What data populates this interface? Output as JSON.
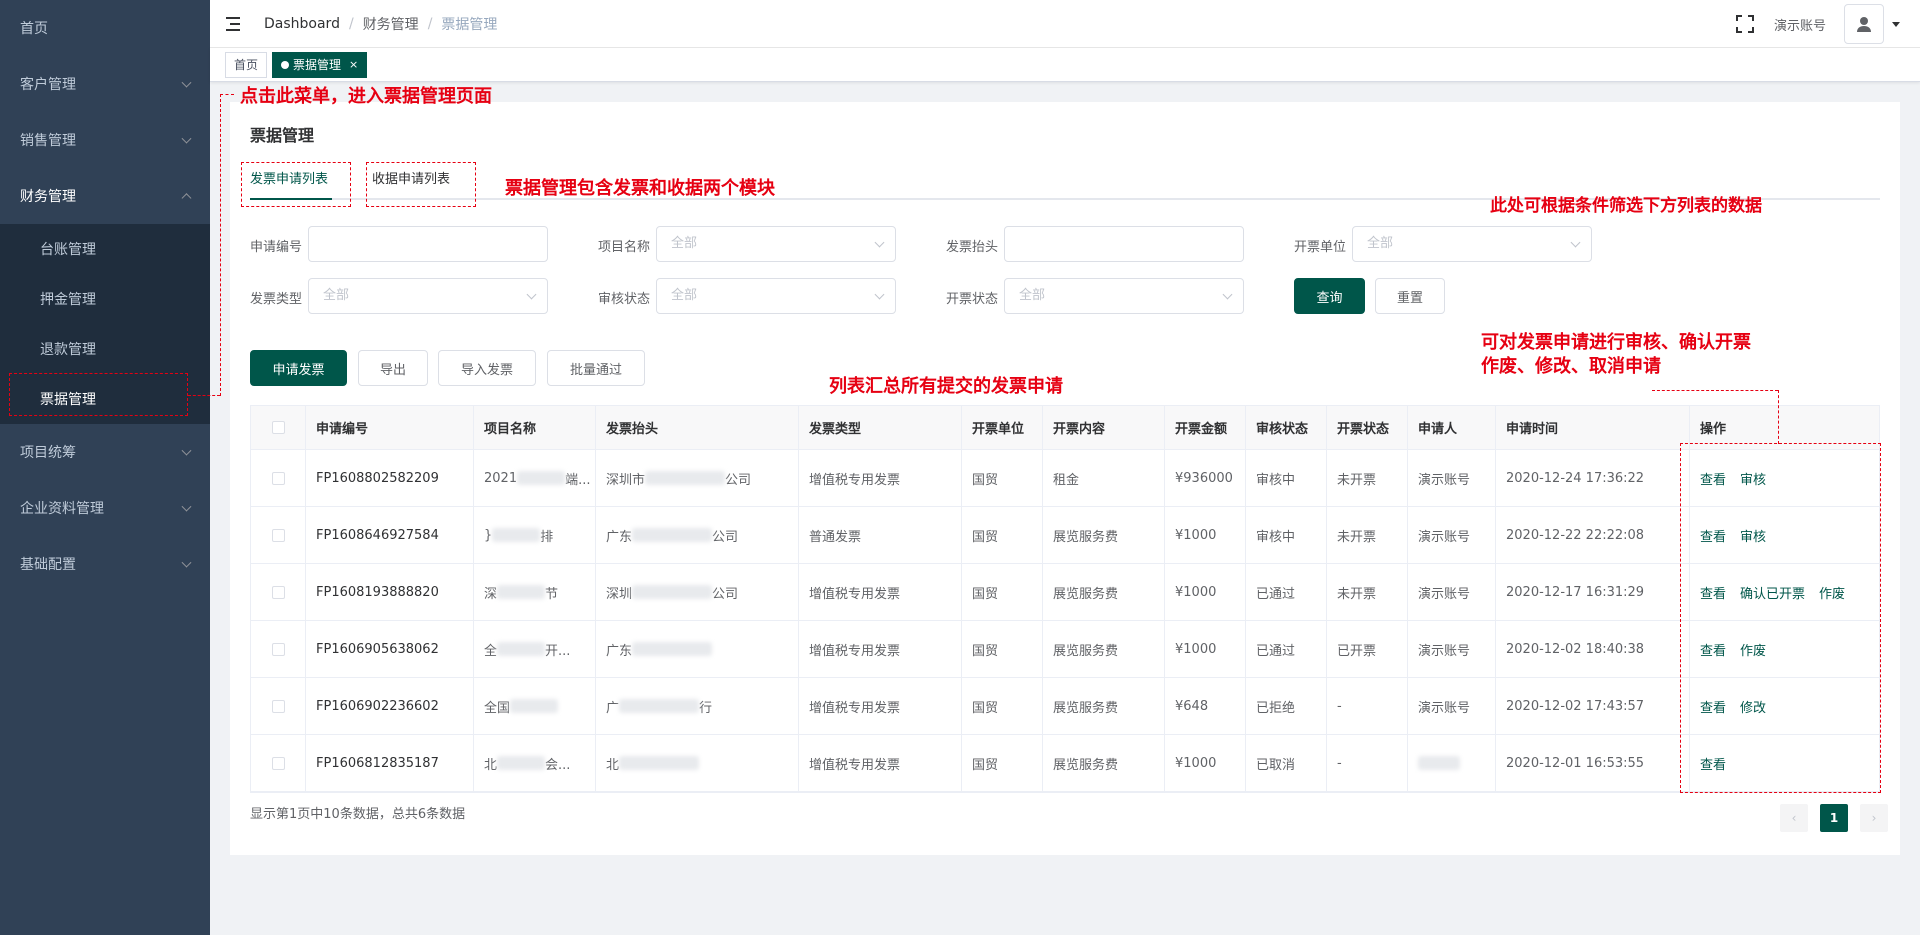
{
  "sidebar": {
    "home": "首页",
    "items": [
      {
        "label": "客户管理"
      },
      {
        "label": "销售管理"
      },
      {
        "label": "财务管理"
      }
    ],
    "finance_sub": [
      {
        "label": "台账管理"
      },
      {
        "label": "押金管理"
      },
      {
        "label": "退款管理"
      },
      {
        "label": "票据管理"
      }
    ],
    "items_after": [
      {
        "label": "项目统筹"
      },
      {
        "label": "企业资料管理"
      },
      {
        "label": "基础配置"
      }
    ]
  },
  "navbar": {
    "breadcrumb": [
      "Dashboard",
      "财务管理",
      "票据管理"
    ],
    "separator": "/",
    "user_name": "演示账号"
  },
  "tags": {
    "home": "首页",
    "active": "票据管理",
    "close": "×"
  },
  "page": {
    "title": "票据管理",
    "tabs": [
      "发票申请列表",
      "收据申请列表"
    ]
  },
  "filters": {
    "apply_no": {
      "label": "申请编号",
      "value": ""
    },
    "project": {
      "label": "项目名称",
      "placeholder": "全部"
    },
    "invoice_header": {
      "label": "发票抬头",
      "value": ""
    },
    "issuer": {
      "label": "开票单位",
      "placeholder": "全部"
    },
    "invoice_type": {
      "label": "发票类型",
      "placeholder": "全部"
    },
    "audit_status": {
      "label": "审核状态",
      "placeholder": "全部"
    },
    "invoice_status": {
      "label": "开票状态",
      "placeholder": "全部"
    },
    "query_btn": "查询",
    "reset_btn": "重置"
  },
  "actions": {
    "apply": "申请发票",
    "export": "导出",
    "import": "导入发票",
    "batch_approve": "批量通过"
  },
  "table": {
    "columns": [
      "申请编号",
      "项目名称",
      "发票抬头",
      "发票类型",
      "开票单位",
      "开票内容",
      "开票金额",
      "审核状态",
      "开票状态",
      "申请人",
      "申请时间",
      "操作"
    ],
    "rows": [
      {
        "code": "FP1608802582209",
        "project_a": "2021",
        "project_b": "端...",
        "header_a": "深圳市",
        "header_b": "公司",
        "type": "增值税专用发票",
        "unit": "国贸",
        "content": "租金",
        "amount": "¥936000",
        "audit": "审核中",
        "invoice": "未开票",
        "applicant": "演示账号",
        "time": "2020-12-24 17:36:22",
        "ops": [
          "查看",
          "审核"
        ]
      },
      {
        "code": "FP1608646927584",
        "project_a": "}",
        "project_b": "排",
        "header_a": "广东",
        "header_b": "公司",
        "type": "普通发票",
        "unit": "国贸",
        "content": "展览服务费",
        "amount": "¥1000",
        "audit": "审核中",
        "invoice": "未开票",
        "applicant": "演示账号",
        "time": "2020-12-22 22:22:08",
        "ops": [
          "查看",
          "审核"
        ]
      },
      {
        "code": "FP1608193888820",
        "project_a": "深",
        "project_b": "节",
        "header_a": "深圳",
        "header_b": "公司",
        "type": "增值税专用发票",
        "unit": "国贸",
        "content": "展览服务费",
        "amount": "¥1000",
        "audit": "已通过",
        "invoice": "未开票",
        "applicant": "演示账号",
        "time": "2020-12-17 16:31:29",
        "ops": [
          "查看",
          "确认已开票",
          "作废"
        ]
      },
      {
        "code": "FP1606905638062",
        "project_a": "全",
        "project_b": "开...",
        "header_a": "广东",
        "header_b": "",
        "type": "增值税专用发票",
        "unit": "国贸",
        "content": "展览服务费",
        "amount": "¥1000",
        "audit": "已通过",
        "invoice": "已开票",
        "applicant": "演示账号",
        "time": "2020-12-02 18:40:38",
        "ops": [
          "查看",
          "作废"
        ]
      },
      {
        "code": "FP1606902236602",
        "project_a": "全国",
        "project_b": "",
        "header_a": "广",
        "header_b": "行",
        "type": "增值税专用发票",
        "unit": "国贸",
        "content": "展览服务费",
        "amount": "¥648",
        "audit": "已拒绝",
        "invoice": "-",
        "applicant": "演示账号",
        "time": "2020-12-02 17:43:57",
        "ops": [
          "查看",
          "修改"
        ]
      },
      {
        "code": "FP1606812835187",
        "project_a": "北",
        "project_b": "会...",
        "header_a": "北",
        "header_b": "",
        "type": "增值税专用发票",
        "unit": "国贸",
        "content": "展览服务费",
        "amount": "¥1000",
        "audit": "已取消",
        "invoice": "-",
        "applicant": "",
        "time": "2020-12-01 16:53:55",
        "ops": [
          "查看"
        ]
      }
    ]
  },
  "pagination": {
    "info": "显示第1页中10条数据，总共6条数据",
    "prev": "‹",
    "current": "1",
    "next": "›"
  },
  "annotations": {
    "menu_note": "点击此菜单，进入票据管理页面",
    "tabs_note": "票据管理包含发票和收据两个模块",
    "filter_note": "此处可根据条件筛选下方列表的数据",
    "list_note": "列表汇总所有提交的发票申请",
    "ops_note_1": "可对发票申请进行审核、确认开票",
    "ops_note_2": "作废、修改、取消申请"
  },
  "colors": {
    "sidebar_bg": "#304156",
    "submenu_bg": "#1f2d3d",
    "primary": "#00564a",
    "annotation": "#e60012"
  }
}
